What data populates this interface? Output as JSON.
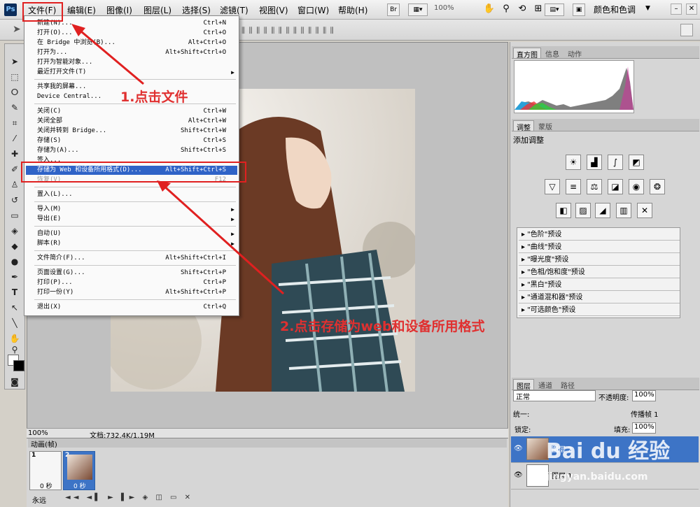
{
  "app": {
    "logo": "Ps"
  },
  "menubar": {
    "items": [
      "文件(F)",
      "编辑(E)",
      "图像(I)",
      "图层(L)",
      "选择(S)",
      "滤镜(T)",
      "视图(V)",
      "窗口(W)",
      "帮助(H)"
    ],
    "bridge_label": "Br",
    "zoom": "100%",
    "workspace": "颜色和色调"
  },
  "file_menu": {
    "items": [
      {
        "label": "新建(N)...",
        "shortcut": "Ctrl+N"
      },
      {
        "label": "打开(O)...",
        "shortcut": "Ctrl+O"
      },
      {
        "label": "在 Bridge 中浏览(B)...",
        "shortcut": "Alt+Ctrl+O"
      },
      {
        "label": "打开为...",
        "shortcut": "Alt+Shift+Ctrl+O"
      },
      {
        "label": "打开为智能对象...",
        "shortcut": ""
      },
      {
        "label": "最近打开文件(T)",
        "shortcut": "",
        "submenu": true
      },
      {
        "label": "共享我的屏幕...",
        "shortcut": ""
      },
      {
        "label": "Device Central...",
        "shortcut": ""
      },
      {
        "label": "关闭(C)",
        "shortcut": "Ctrl+W"
      },
      {
        "label": "关闭全部",
        "shortcut": "Alt+Ctrl+W"
      },
      {
        "label": "关闭并转到 Bridge...",
        "shortcut": "Shift+Ctrl+W"
      },
      {
        "label": "存储(S)",
        "shortcut": "Ctrl+S"
      },
      {
        "label": "存储为(A)...",
        "shortcut": "Shift+Ctrl+S"
      },
      {
        "label": "签入...",
        "shortcut": ""
      },
      {
        "label": "存储为 Web 和设备所用格式(D)...",
        "shortcut": "Alt+Shift+Ctrl+S",
        "highlight": true
      },
      {
        "label": "恢复(V)",
        "shortcut": "F12",
        "disabled": true
      },
      {
        "label": "置入(L)...",
        "shortcut": ""
      },
      {
        "label": "导入(M)",
        "shortcut": "",
        "submenu": true
      },
      {
        "label": "导出(E)",
        "shortcut": "",
        "submenu": true
      },
      {
        "label": "自动(U)",
        "shortcut": "",
        "submenu": true
      },
      {
        "label": "脚本(R)",
        "shortcut": "",
        "submenu": true
      },
      {
        "label": "文件简介(F)...",
        "shortcut": "Alt+Shift+Ctrl+I"
      },
      {
        "label": "页面设置(G)...",
        "shortcut": "Shift+Ctrl+P"
      },
      {
        "label": "打印(P)...",
        "shortcut": "Ctrl+P"
      },
      {
        "label": "打印一份(Y)",
        "shortcut": "Alt+Shift+Ctrl+P"
      },
      {
        "label": "退出(X)",
        "shortcut": "Ctrl+Q"
      }
    ]
  },
  "annotations": {
    "step1": "1.点击文件",
    "step2": "2.点击存储为web和设备所用格式"
  },
  "status": {
    "zoom": "100%",
    "doc": "文档:732.4K/1.19M"
  },
  "animation": {
    "title": "动画(帧)",
    "frames": [
      {
        "num": "1",
        "delay": "0 秒"
      },
      {
        "num": "2",
        "delay": "0 秒"
      }
    ],
    "loop": "永远"
  },
  "panels": {
    "top_tabs": [
      "直方图",
      "信息",
      "动作"
    ],
    "mid_tabs": [
      "调整",
      "蒙版"
    ],
    "add_adjustment": "添加调整",
    "presets": [
      "\"色阶\"预设",
      "\"曲线\"预设",
      "\"曝光度\"预设",
      "\"色相/饱和度\"预设",
      "\"黑白\"预设",
      "\"通道混和器\"预设",
      "\"可选颜色\"预设"
    ],
    "layer_tabs": [
      "图层",
      "通道",
      "路径"
    ],
    "blend_mode": "正常",
    "opacity_label": "不透明度:",
    "opacity": "100%",
    "unify_label": "统一:",
    "propagate": "传播帧 1",
    "lock_label": "锁定:",
    "fill_label": "填充:",
    "fill": "100%",
    "layers": [
      "图层 2",
      "图层 1"
    ]
  },
  "watermark": {
    "brand": "Bai du 经验",
    "url": "jingyan.baidu.com"
  }
}
